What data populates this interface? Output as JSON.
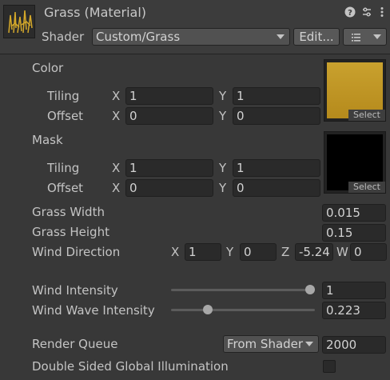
{
  "header": {
    "title": "Grass (Material)",
    "shader_label": "Shader",
    "shader_value": "Custom/Grass",
    "edit_label": "Edit...",
    "help_icon": "help-icon",
    "settings_icon": "presets-icon",
    "menu_icon": "more-menu-icon"
  },
  "textures": [
    {
      "label": "Color",
      "swatch_color": "#c9a12e",
      "select_label": "Select",
      "tiling_label": "Tiling",
      "offset_label": "Offset",
      "tiling": {
        "x": "1",
        "y": "1"
      },
      "offset": {
        "x": "0",
        "y": "0"
      }
    },
    {
      "label": "Mask",
      "swatch_color": "#000000",
      "select_label": "Select",
      "tiling_label": "Tiling",
      "offset_label": "Offset",
      "tiling": {
        "x": "1",
        "y": "1"
      },
      "offset": {
        "x": "0",
        "y": "0"
      }
    }
  ],
  "axis": {
    "x": "X",
    "y": "Y",
    "z": "Z",
    "w": "W"
  },
  "props": {
    "grass_width": {
      "label": "Grass Width",
      "value": "0.015"
    },
    "grass_height": {
      "label": "Grass Height",
      "value": "0.15"
    },
    "wind_direction": {
      "label": "Wind Direction",
      "x": "1",
      "y": "0",
      "z": "-5.24",
      "w": "0"
    },
    "wind_intensity": {
      "label": "Wind Intensity",
      "value": "1",
      "slider_fraction": 1.0
    },
    "wind_wave_intensity": {
      "label": "Wind Wave Intensity",
      "value": "0.223",
      "slider_fraction": 0.24
    },
    "render_queue": {
      "label": "Render Queue",
      "mode": "From Shader",
      "value": "2000"
    },
    "double_sided_gi": {
      "label": "Double Sided Global Illumination",
      "checked": false
    }
  }
}
